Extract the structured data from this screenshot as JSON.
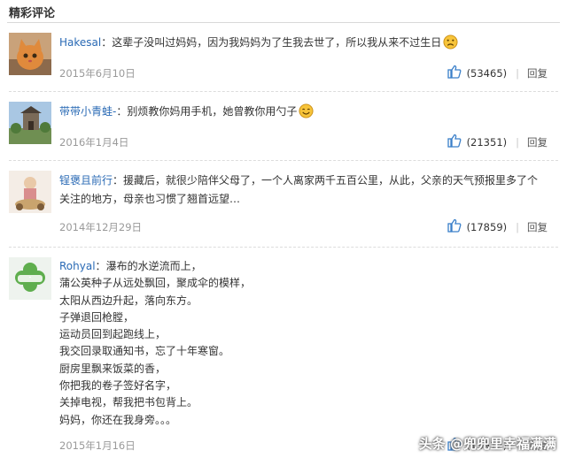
{
  "section_title": "精彩评论",
  "comments": [
    {
      "username": "Hakesal",
      "separator": "：",
      "text": "这辈子没叫过妈妈，因为我妈妈为了生我去世了，所以我从来不过生日",
      "emoji": "sad-face",
      "date": "2015年6月10日",
      "likes": "(53465)",
      "reply_label": "回复"
    },
    {
      "username": "带带小青蛙-",
      "separator": "：",
      "text": "别烦教你妈用手机，她曾教你用勺子",
      "emoji": "smile-face",
      "date": "2016年1月4日",
      "likes": "(21351)",
      "reply_label": "回复"
    },
    {
      "username": "锃褒且前行",
      "separator": "：",
      "text": "援藏后，就很少陪伴父母了，一个人离家两千五百公里，从此，父亲的天气预报里多了个关注的地方，母亲也习惯了翘首远望…",
      "date": "2014年12月29日",
      "likes": "(17859)",
      "reply_label": "回复"
    },
    {
      "username": "Rohyal",
      "separator": "：",
      "lines": [
        "瀑布的水逆流而上，",
        "蒲公英种子从远处飘回，聚成伞的模样，",
        "太阳从西边升起，落向东方。",
        "子弹退回枪膛，",
        "运动员回到起跑线上，",
        "我交回录取通知书，忘了十年寒窗。",
        "厨房里飘来饭菜的香，",
        "你把我的卷子签好名字，",
        "关掉电视，帮我把书包背上。",
        "妈妈，你还在我身旁。。。"
      ],
      "date": "2015年1月16日",
      "likes": "(13912)",
      "reply_label": "回复"
    }
  ],
  "watermark": "头条 @兜兜里幸福满满",
  "colors": {
    "username": "#2a6ab5",
    "thumb": "#3a7fc9",
    "date": "#9a9a9a"
  }
}
